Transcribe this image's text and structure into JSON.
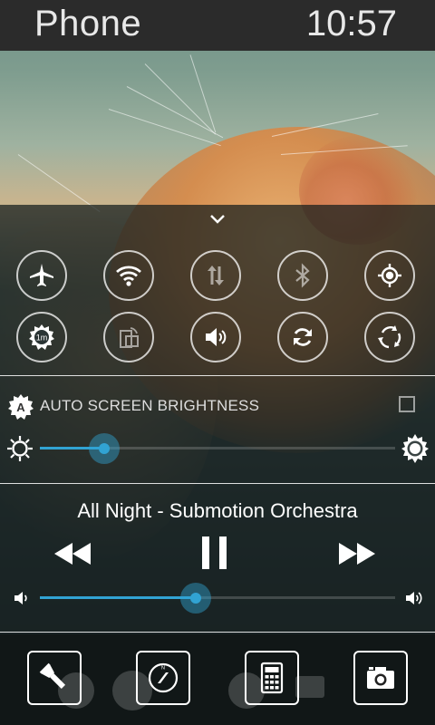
{
  "status_bar": {
    "app_name": "Phone",
    "time": "10:57"
  },
  "quick_settings": {
    "row1": [
      "airplane-mode",
      "wifi",
      "mobile-data",
      "bluetooth",
      "location"
    ],
    "row2": [
      "screen-timeout",
      "rotate-lock",
      "sound",
      "sync",
      "auto-rotate"
    ],
    "timeout_badge": "1m"
  },
  "brightness": {
    "auto_label": "AUTO SCREEN BRIGHTNESS",
    "auto_badge": "A",
    "auto_checked": false,
    "level": 0.18
  },
  "media": {
    "now_playing": "All Night - Submotion Orchestra",
    "state": "playing",
    "volume": 0.44
  },
  "dock": [
    "flashlight",
    "compass",
    "calculator",
    "camera"
  ],
  "colors": {
    "accent": "#31a3d3",
    "status_bar": "#2b2b2b"
  }
}
